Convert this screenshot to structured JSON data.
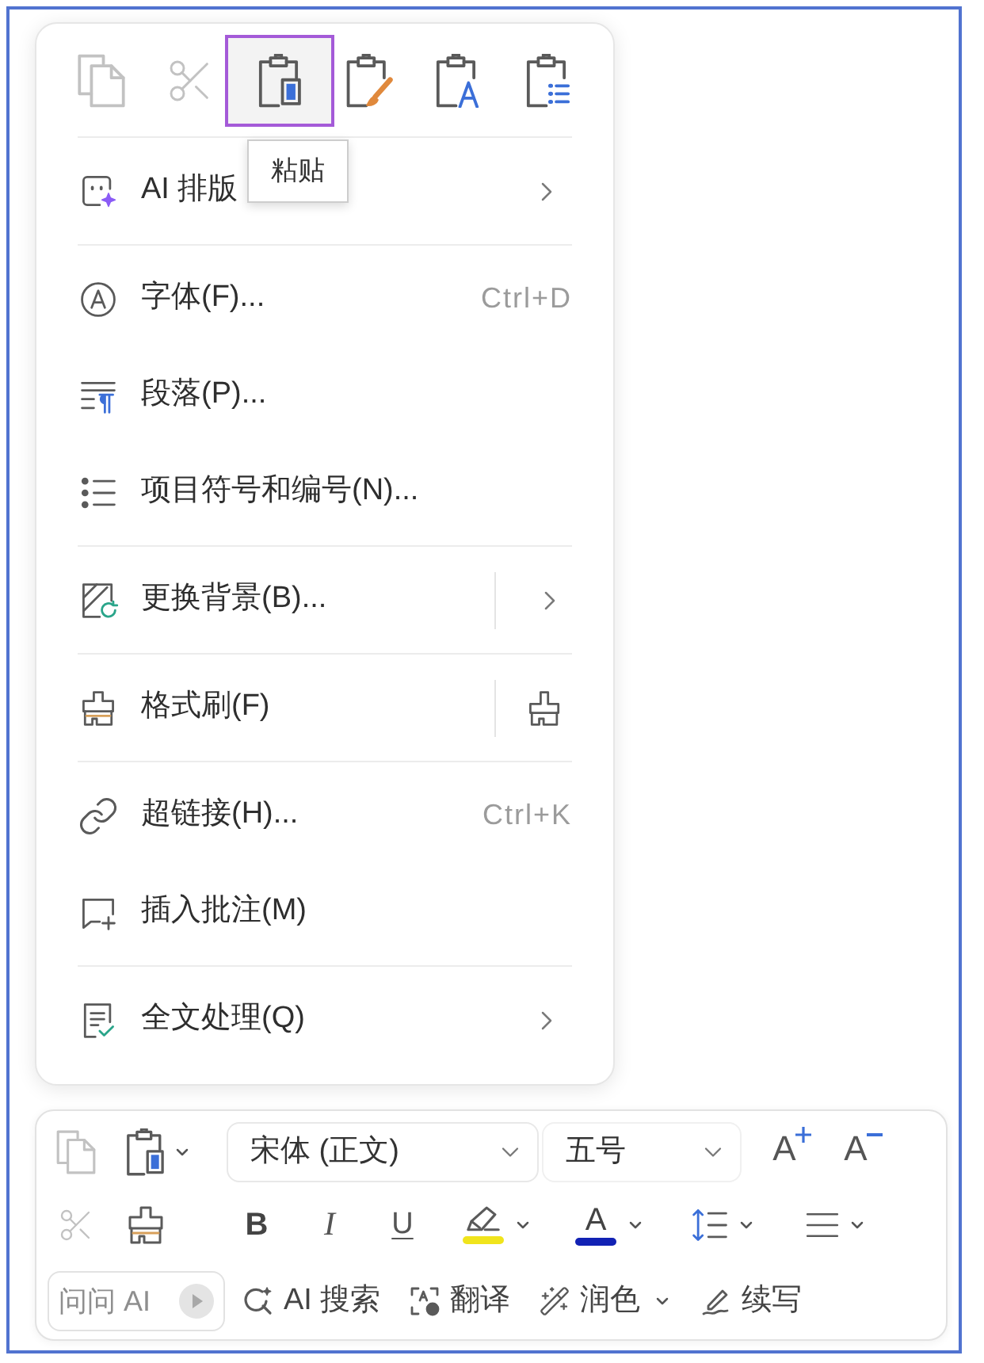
{
  "paste_options": [
    {
      "disabled": true,
      "selected": false
    },
    {
      "disabled": true,
      "selected": false
    },
    {
      "disabled": false,
      "selected": true
    },
    {
      "disabled": false,
      "selected": false
    },
    {
      "disabled": false,
      "selected": false
    },
    {
      "disabled": false,
      "selected": false
    }
  ],
  "tooltip": {
    "text": "粘贴"
  },
  "menu": {
    "groups": [
      [
        {
          "kind": "submenu",
          "label": "AI 排版",
          "split": false
        }
      ],
      [
        {
          "kind": "plain",
          "label": "字体(F)...",
          "shortcut": "Ctrl+D"
        },
        {
          "kind": "plain",
          "label": "段落(P)..."
        },
        {
          "kind": "plain",
          "label": "项目符号和编号(N)..."
        }
      ],
      [
        {
          "kind": "submenu",
          "label": "更换背景(B)...",
          "split": true
        }
      ],
      [
        {
          "kind": "brush",
          "label": "格式刷(F)",
          "split": true
        }
      ],
      [
        {
          "kind": "plain",
          "label": "超链接(H)...",
          "shortcut": "Ctrl+K"
        },
        {
          "kind": "plain",
          "label": "插入批注(M)"
        }
      ],
      [
        {
          "kind": "submenu",
          "label": "全文处理(Q)",
          "split": false
        }
      ]
    ]
  },
  "mini_toolbar": {
    "copy": {
      "disabled": true
    },
    "font": {
      "value": "宋体 (正文)"
    },
    "size": {
      "value": "五号"
    },
    "grow_font": {
      "label": "A"
    },
    "shrink_font": {
      "label": "A"
    },
    "cut": {
      "disabled": true
    },
    "bold": {
      "label": "B"
    },
    "italic": {
      "label": "I"
    },
    "underline": {
      "label": "U"
    },
    "highlight": {
      "color": "#f0e41c"
    },
    "font_color": {
      "label": "A",
      "color": "#1222b4"
    },
    "ask_ai": {
      "placeholder": "问问 AI"
    },
    "actions": [
      {
        "label": "AI 搜索",
        "dropdown": false
      },
      {
        "label": "翻译",
        "dropdown": false
      },
      {
        "label": "润色",
        "dropdown": true
      },
      {
        "label": "续写",
        "dropdown": false
      }
    ]
  }
}
